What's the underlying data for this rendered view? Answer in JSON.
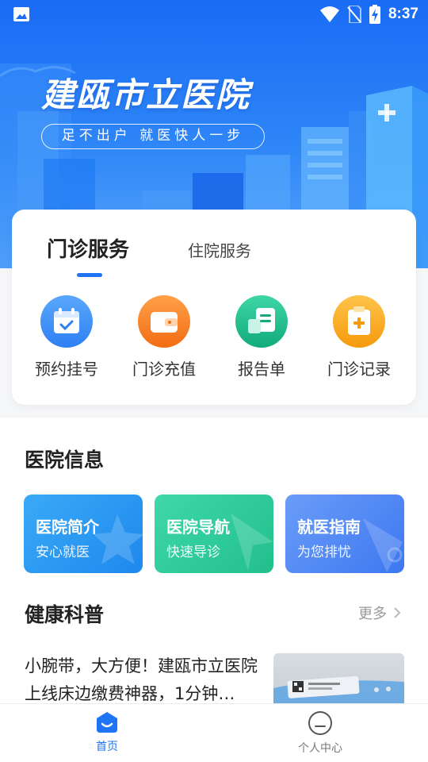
{
  "status_bar": {
    "time": "8:37"
  },
  "banner": {
    "hospital_name": "建瓯市立医院",
    "slogan": "足不出户  就医快人一步"
  },
  "services": {
    "tabs": [
      {
        "label": "门诊服务",
        "active": true
      },
      {
        "label": "住院服务",
        "active": false
      }
    ],
    "items": [
      {
        "label": "预约挂号",
        "icon": "calendar-icon",
        "color": "#3a8cf7"
      },
      {
        "label": "门诊充值",
        "icon": "wallet-icon",
        "color": "#f57a1c"
      },
      {
        "label": "报告单",
        "icon": "report-icon",
        "color": "#1fb98c"
      },
      {
        "label": "门诊记录",
        "icon": "clipboard-icon",
        "color": "#f5a412"
      }
    ]
  },
  "hospital_info": {
    "title": "医院信息",
    "cards": [
      {
        "title": "医院简介",
        "subtitle": "安心就医",
        "color": "#2d9df0"
      },
      {
        "title": "医院导航",
        "subtitle": "快速导诊",
        "color": "#2fcb9a"
      },
      {
        "title": "就医指南",
        "subtitle": "为您排忧",
        "color": "#4f87f5"
      }
    ]
  },
  "health": {
    "title": "健康科普",
    "more_label": "更多",
    "article": {
      "title": "小腕带，大方便！建瓯市立医院上线床边缴费神器，1分钟…"
    }
  },
  "bottom_nav": {
    "items": [
      {
        "label": "首页",
        "icon": "home-icon",
        "active": true
      },
      {
        "label": "个人中心",
        "icon": "profile-icon",
        "active": false
      }
    ]
  },
  "colors": {
    "accent": "#1e74f5",
    "banner_top": "#1a6cf5"
  }
}
